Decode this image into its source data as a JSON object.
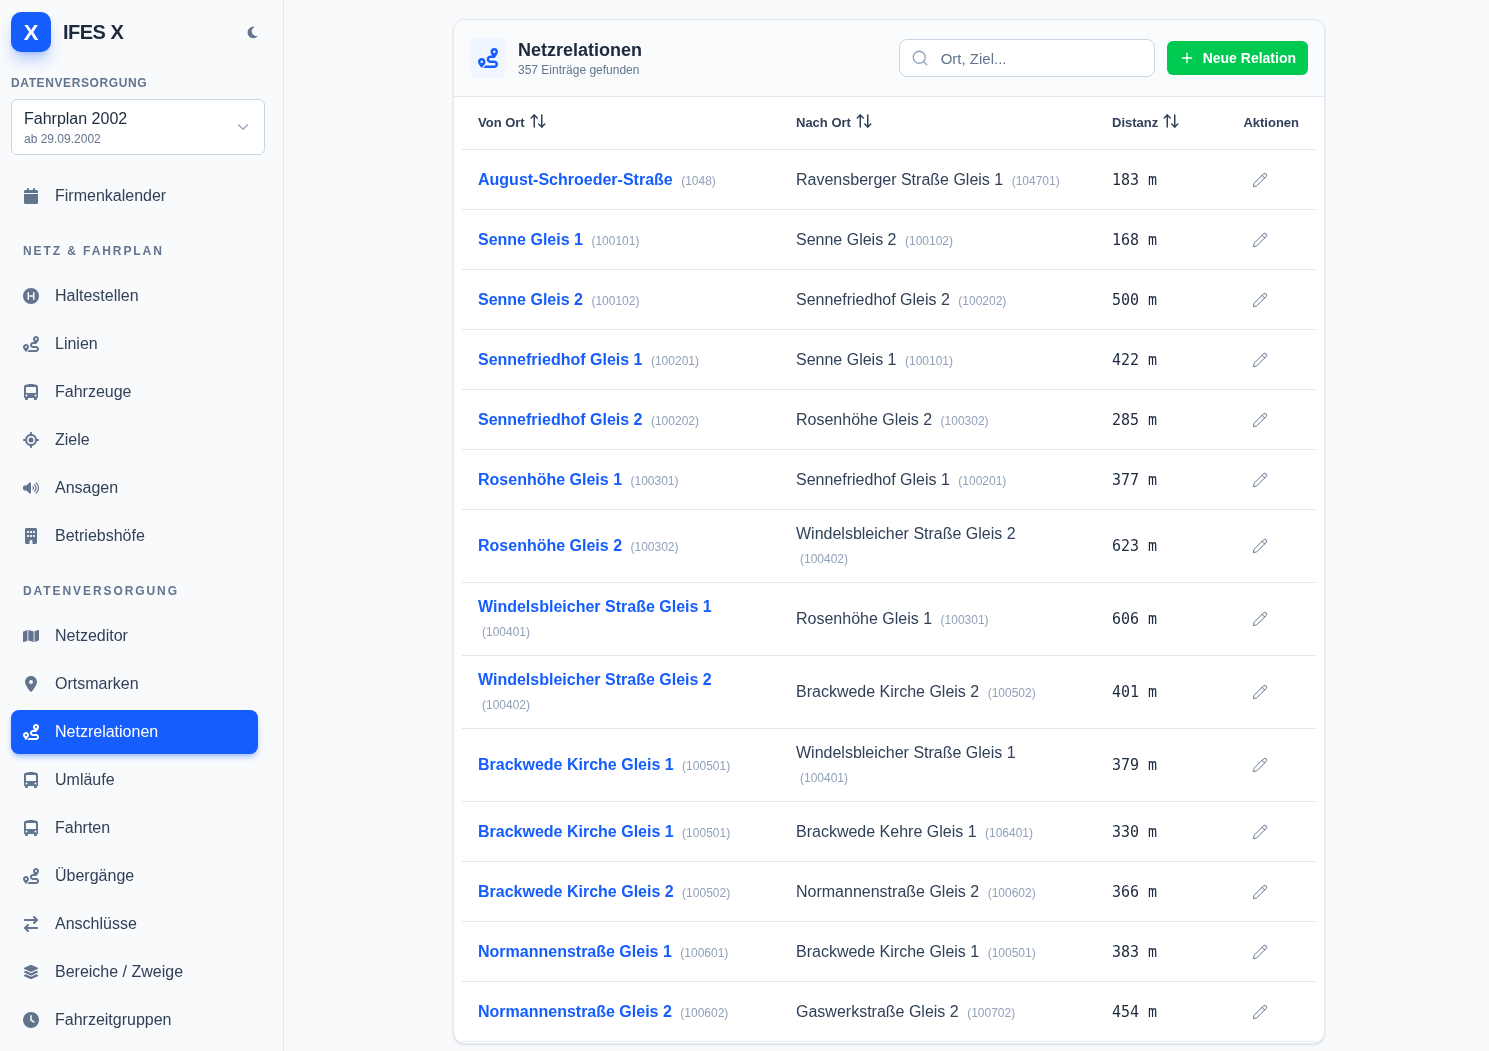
{
  "sidebar": {
    "logo": {
      "mark": "X",
      "title": "IFES X"
    },
    "data_supply": {
      "label": "DATENVERSORGUNG",
      "timetable": {
        "name": "Fahrplan 2002",
        "valid_from": "ab 29.09.2002"
      }
    },
    "nav_groups": [
      {
        "items": [
          {
            "label": "Firmenkalender",
            "selected": false
          }
        ]
      },
      {
        "title": "NETZ & FAHRPLAN",
        "items": [
          {
            "label": "Haltestellen",
            "selected": false
          },
          {
            "label": "Linien",
            "selected": false
          },
          {
            "label": "Fahrzeuge",
            "selected": false
          },
          {
            "label": "Ziele",
            "selected": false
          },
          {
            "label": "Ansagen",
            "selected": false
          },
          {
            "label": "Betriebshöfe",
            "selected": false
          }
        ]
      },
      {
        "title": "DATENVERSORGUNG",
        "items": [
          {
            "label": "Netzeditor",
            "selected": false
          },
          {
            "label": "Ortsmarken",
            "selected": false
          },
          {
            "label": "Netzrelationen",
            "selected": true
          },
          {
            "label": "Umläufe",
            "selected": false
          },
          {
            "label": "Fahrten",
            "selected": false
          },
          {
            "label": "Übergänge",
            "selected": false
          },
          {
            "label": "Anschlüsse",
            "selected": false
          },
          {
            "label": "Bereiche / Zweige",
            "selected": false
          },
          {
            "label": "Fahrzeitgruppen",
            "selected": false
          }
        ]
      }
    ]
  },
  "main": {
    "title": "Netzrelationen",
    "subtitle": "357 Einträge gefunden",
    "search": {
      "placeholder": "Ort, Ziel..."
    },
    "new_button": "Neue Relation",
    "table": {
      "columns": [
        {
          "label": "Von Ort",
          "sortable": true
        },
        {
          "label": "Nach Ort",
          "sortable": true
        },
        {
          "label": "Distanz",
          "sortable": true
        },
        {
          "label": "Aktionen",
          "sortable": false
        }
      ],
      "rows": [
        {
          "from": {
            "name": "August-Schroeder-Straße",
            "id": "(1048)"
          },
          "to": {
            "name": "Ravensberger Straße Gleis 1",
            "id": "(104701)"
          },
          "distance": "183 m"
        },
        {
          "from": {
            "name": "Senne Gleis 1",
            "id": "(100101)"
          },
          "to": {
            "name": "Senne Gleis 2",
            "id": "(100102)"
          },
          "distance": "168 m"
        },
        {
          "from": {
            "name": "Senne Gleis 2",
            "id": "(100102)"
          },
          "to": {
            "name": "Sennefriedhof Gleis 2",
            "id": "(100202)"
          },
          "distance": "500 m"
        },
        {
          "from": {
            "name": "Sennefriedhof Gleis 1",
            "id": "(100201)"
          },
          "to": {
            "name": "Senne Gleis 1",
            "id": "(100101)"
          },
          "distance": "422 m"
        },
        {
          "from": {
            "name": "Sennefriedhof Gleis 2",
            "id": "(100202)"
          },
          "to": {
            "name": "Rosenhöhe Gleis 2",
            "id": "(100302)"
          },
          "distance": "285 m"
        },
        {
          "from": {
            "name": "Rosenhöhe Gleis 1",
            "id": "(100301)"
          },
          "to": {
            "name": "Sennefriedhof Gleis 1",
            "id": "(100201)"
          },
          "distance": "377 m"
        },
        {
          "from": {
            "name": "Rosenhöhe Gleis 2",
            "id": "(100302)"
          },
          "to": {
            "name": "Windelsbleicher Straße Gleis 2",
            "id": "(100402)"
          },
          "distance": "623 m"
        },
        {
          "from": {
            "name": "Windelsbleicher Straße Gleis 1",
            "id": "(100401)"
          },
          "to": {
            "name": "Rosenhöhe Gleis 1",
            "id": "(100301)"
          },
          "distance": "606 m"
        },
        {
          "from": {
            "name": "Windelsbleicher Straße Gleis 2",
            "id": "(100402)"
          },
          "to": {
            "name": "Brackwede Kirche Gleis 2",
            "id": "(100502)"
          },
          "distance": "401 m"
        },
        {
          "from": {
            "name": "Brackwede Kirche Gleis 1",
            "id": "(100501)"
          },
          "to": {
            "name": "Windelsbleicher Straße Gleis 1",
            "id": "(100401)"
          },
          "distance": "379 m"
        },
        {
          "from": {
            "name": "Brackwede Kirche Gleis 1",
            "id": "(100501)"
          },
          "to": {
            "name": "Brackwede Kehre Gleis 1",
            "id": "(106401)"
          },
          "distance": "330 m"
        },
        {
          "from": {
            "name": "Brackwede Kirche Gleis 2",
            "id": "(100502)"
          },
          "to": {
            "name": "Normannenstraße Gleis 2",
            "id": "(100602)"
          },
          "distance": "366 m"
        },
        {
          "from": {
            "name": "Normannenstraße Gleis 1",
            "id": "(100601)"
          },
          "to": {
            "name": "Brackwede Kirche Gleis 1",
            "id": "(100501)"
          },
          "distance": "383 m"
        },
        {
          "from": {
            "name": "Normannenstraße Gleis 2",
            "id": "(100602)"
          },
          "to": {
            "name": "Gaswerkstraße Gleis 2",
            "id": "(100702)"
          },
          "distance": "454 m"
        }
      ]
    }
  }
}
